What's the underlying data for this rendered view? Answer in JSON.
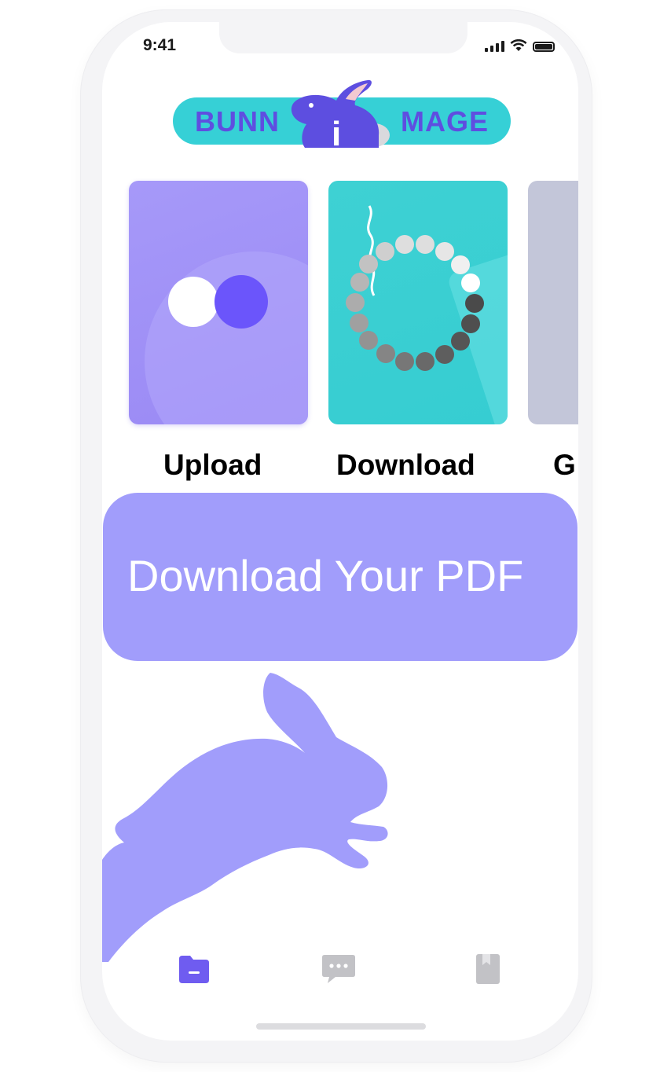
{
  "status_bar": {
    "time": "9:41"
  },
  "logo": {
    "left_text": "BUNN",
    "center_letter": "i",
    "right_text": "MAGE"
  },
  "cards": [
    {
      "label": "Upload",
      "color": "#9d8df6"
    },
    {
      "label": "Download",
      "color": "#3ad0d4"
    },
    {
      "label": "G",
      "color": "#c3c6d9"
    }
  ],
  "action": {
    "label": "Download Your PDF",
    "color": "#a19dfb"
  },
  "tabs": [
    {
      "icon": "folder-icon",
      "active": true,
      "color": "#6f5cf0"
    },
    {
      "icon": "chat-icon",
      "active": false,
      "color": "#c2c2c6"
    },
    {
      "icon": "bookmark-icon",
      "active": false,
      "color": "#c2c2c6"
    }
  ],
  "accent": "#5f4ee0"
}
